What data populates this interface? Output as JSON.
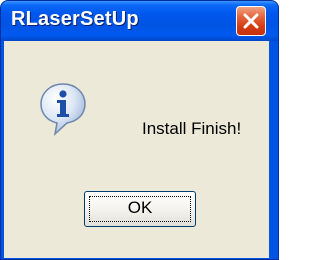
{
  "window": {
    "title": "RLaserSetUp",
    "title_color": "#ffffff",
    "titlebar_color": "#0054e3",
    "client_bg": "#ece9d8"
  },
  "title_buttons": {
    "close_icon": "close-icon",
    "close_color": "#d33c14"
  },
  "dialog": {
    "icon": "info-icon",
    "message": "Install Finish!",
    "ok_label": "OK"
  }
}
